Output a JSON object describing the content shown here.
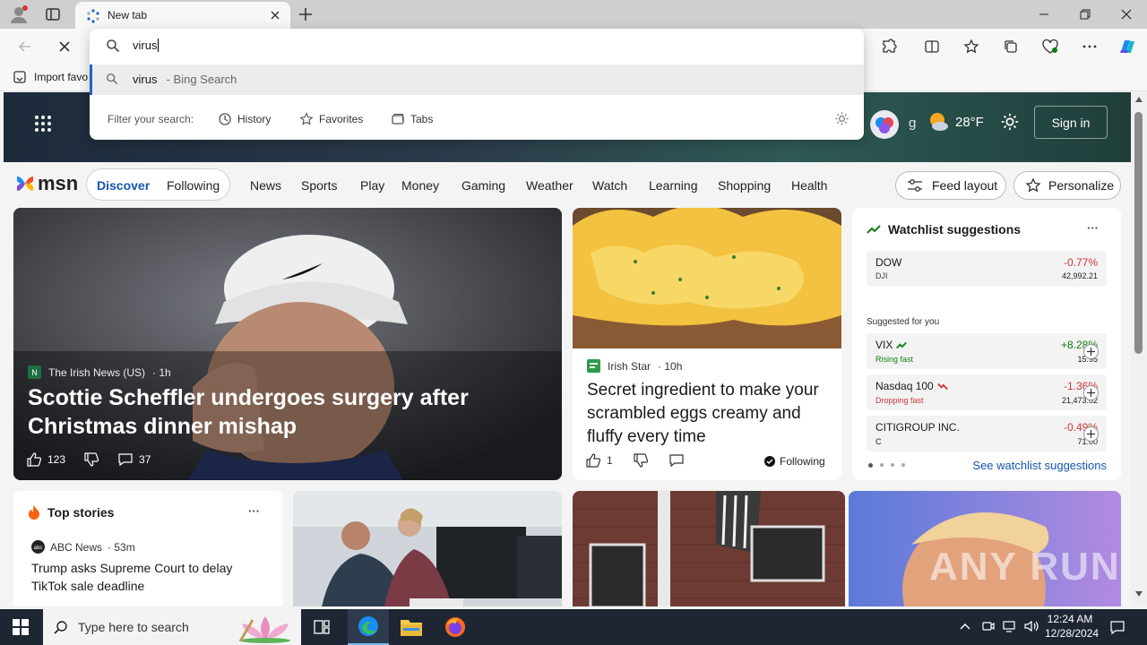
{
  "browser": {
    "tab_title": "New tab",
    "address_value": "virus",
    "favbar_item": "Import favo"
  },
  "omnibox": {
    "suggestion_term": "virus",
    "suggestion_source": " - Bing Search",
    "filter_label": "Filter your search:",
    "filters": [
      "History",
      "Favorites",
      "Tabs"
    ]
  },
  "weather": {
    "partial_text": "g",
    "temperature": "28°F"
  },
  "header": {
    "sign_in": "Sign in"
  },
  "msn": {
    "logo": "msn",
    "nav": [
      "Discover",
      "Following",
      "News",
      "Sports",
      "Play",
      "Money",
      "Gaming",
      "Weather",
      "Watch",
      "Learning",
      "Shopping",
      "Health"
    ],
    "feed_layout": "Feed layout",
    "personalize": "Personalize"
  },
  "hero": {
    "source": "The Irish News (US)",
    "time": "· 1h",
    "headline": "Scottie Scheffler undergoes surgery after Christmas dinner mishap",
    "likes": "123",
    "comments": "37"
  },
  "eggs_card": {
    "source": "Irish Star",
    "time": "· 10h",
    "headline": "Secret ingredient to make your scrambled eggs creamy and fluffy every time",
    "likes": "1",
    "following": "Following"
  },
  "watchlist": {
    "title": "Watchlist suggestions",
    "more": "···",
    "main": {
      "name": "DOW",
      "ticker": "DJI",
      "change": "-0.77%",
      "price": "42,992.21"
    },
    "suggested_label": "Suggested for you",
    "items": [
      {
        "name": "VIX",
        "status": "Rising fast",
        "change": "+8.28%",
        "price": "15.95"
      },
      {
        "name": "Nasdaq 100",
        "status": "Dropping fast",
        "change": "-1.36%",
        "price": "21,473.02"
      },
      {
        "name": "CITIGROUP INC.",
        "status": "C",
        "change": "-0.49%",
        "price": "71.00"
      }
    ],
    "see_more": "See watchlist suggestions"
  },
  "top_stories": {
    "title": "Top stories",
    "more": "···",
    "source": "ABC News",
    "time": "· 53m",
    "headline": "Trump asks Supreme Court to delay TikTok sale deadline"
  },
  "watermark": "ANY RUN",
  "taskbar": {
    "search_placeholder": "Type here to search",
    "time": "12:24 AM",
    "date": "12/28/2024"
  },
  "colors": {
    "accent": "#2264c4",
    "positive": "#107c10",
    "negative": "#d13438",
    "taskbar": "#1e2633"
  }
}
